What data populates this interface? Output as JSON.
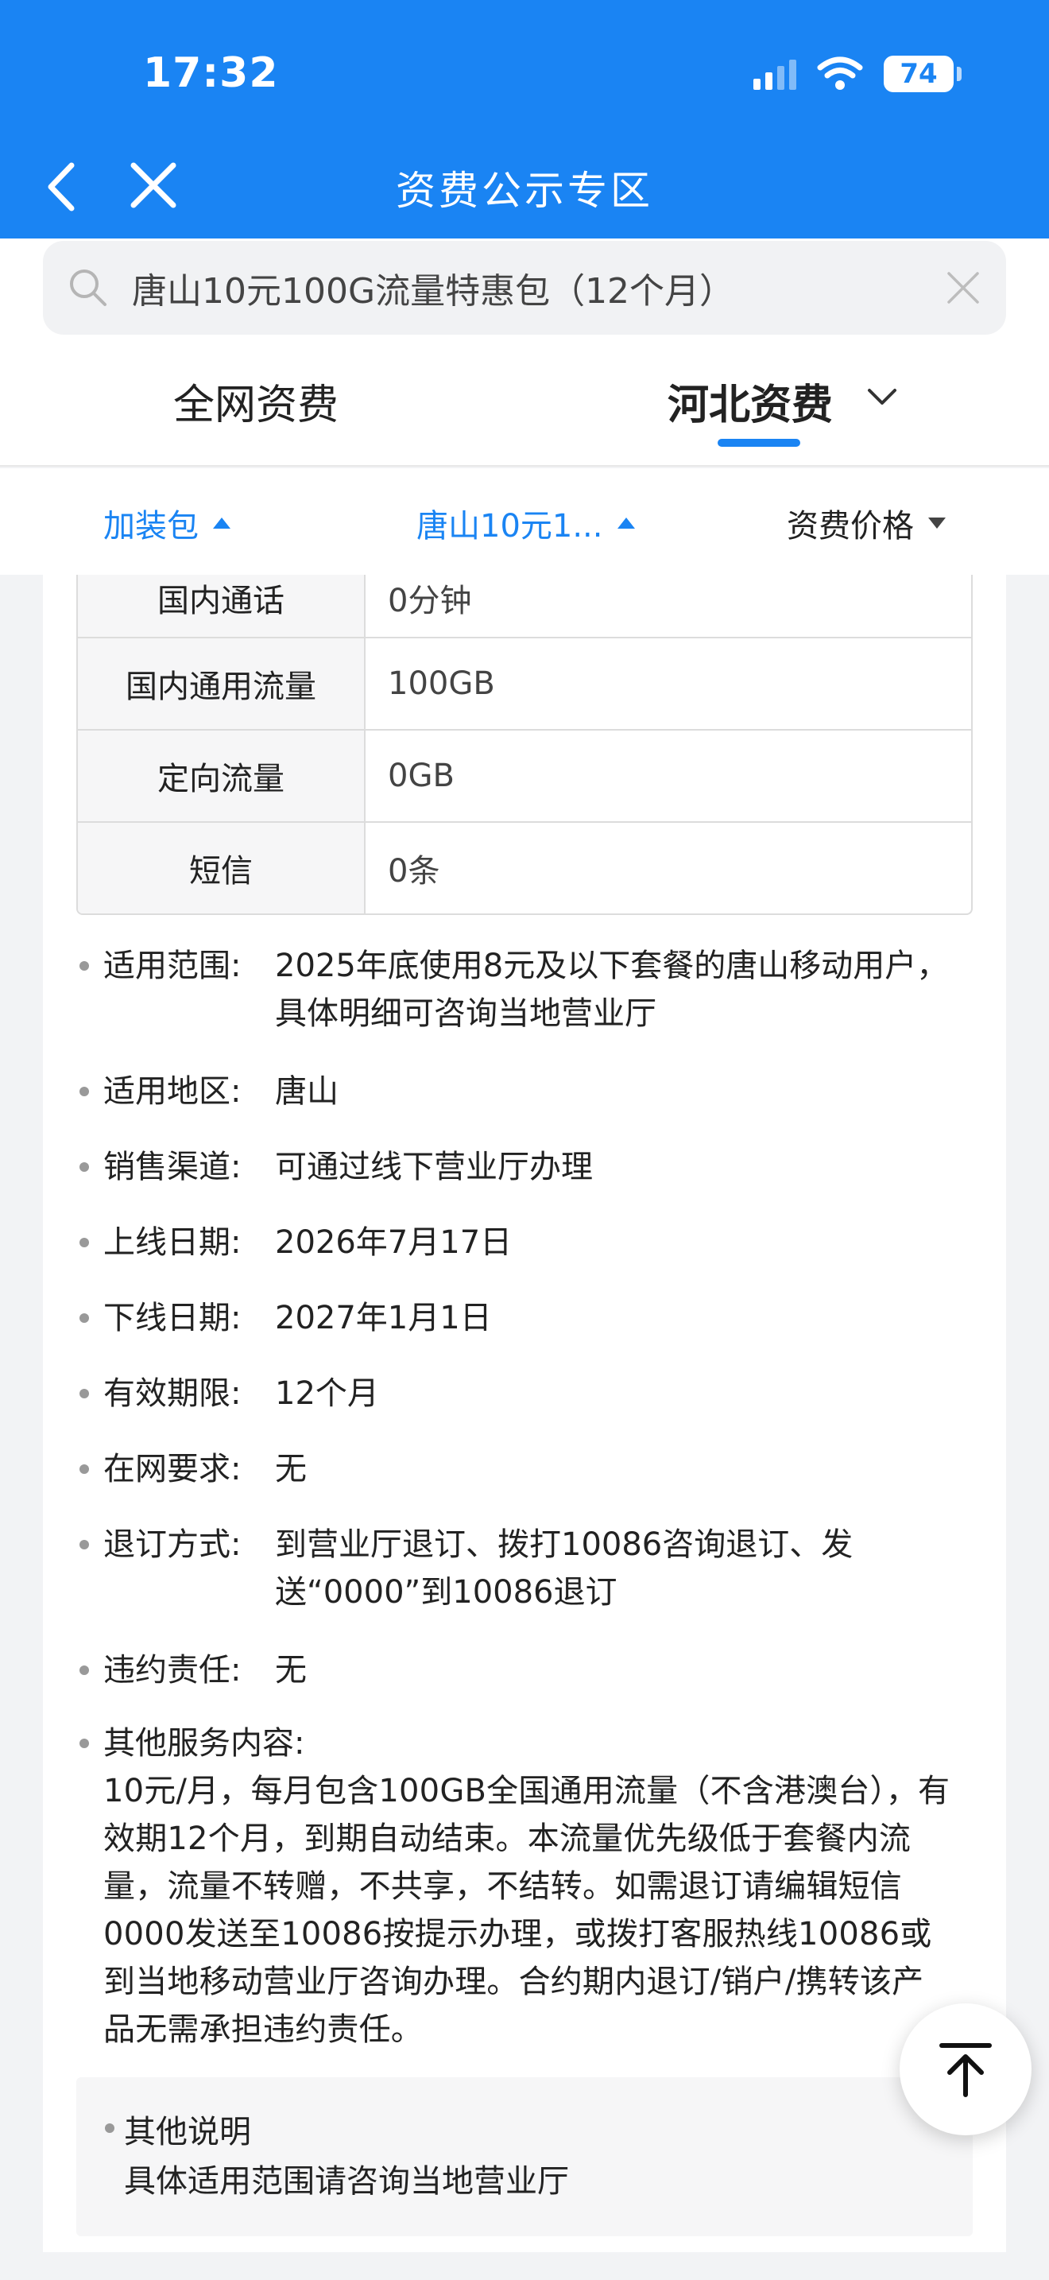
{
  "status_bar": {
    "time": "17:32",
    "battery": "74"
  },
  "nav": {
    "title": "资费公示专区"
  },
  "search": {
    "text": "唐山10元100G流量特惠包（12个月）"
  },
  "region_tabs": {
    "national": "全网资费",
    "hebei": "河北资费"
  },
  "filters": {
    "category": "加装包",
    "product": "唐山10元1...",
    "price": "资费价格"
  },
  "spec_table": [
    {
      "key": "国内通话",
      "value": "0分钟"
    },
    {
      "key": "国内通用流量",
      "value": "100GB"
    },
    {
      "key": "定向流量",
      "value": "0GB"
    },
    {
      "key": "短信",
      "value": "0条"
    }
  ],
  "info": [
    {
      "label": "适用范围:",
      "value": "2025年底使用8元及以下套餐的唐山移动用户，具体明细可咨询当地营业厅"
    },
    {
      "label": "适用地区:",
      "value": "唐山"
    },
    {
      "label": "销售渠道:",
      "value": "可通过线下营业厅办理"
    },
    {
      "label": "上线日期:",
      "value": "2026年7月17日"
    },
    {
      "label": "下线日期:",
      "value": "2027年1月1日"
    },
    {
      "label": "有效期限:",
      "value": "12个月"
    },
    {
      "label": "在网要求:",
      "value": "无"
    },
    {
      "label": "退订方式:",
      "value": "到营业厅退订、拨打10086咨询退订、发送“0000”到10086退订"
    },
    {
      "label": "违约责任:",
      "value": "无"
    }
  ],
  "other_service": {
    "label": "其他服务内容:",
    "body": "10元/月，每月包含100GB全国通用流量（不含港澳台），有效期12个月，到期自动结束。本流量优先级低于套餐内流量，流量不转赠，不共享，不结转。如需退订请编辑短信0000发送至10086按提示办理，或拨打客服热线10086或到当地移动营业厅咨询办理。合约期内退订/销户/携转该产品无需承担违约责任。"
  },
  "note": {
    "title": "其他说明",
    "text": "具体适用范围请咨询当地营业厅"
  },
  "colors": {
    "primary": "#1a84f3"
  },
  "icons": [
    "back-icon",
    "close-icon",
    "search-icon",
    "clear-icon",
    "chevron-down-icon",
    "back-to-top-icon",
    "wifi-icon",
    "signal-icon"
  ]
}
